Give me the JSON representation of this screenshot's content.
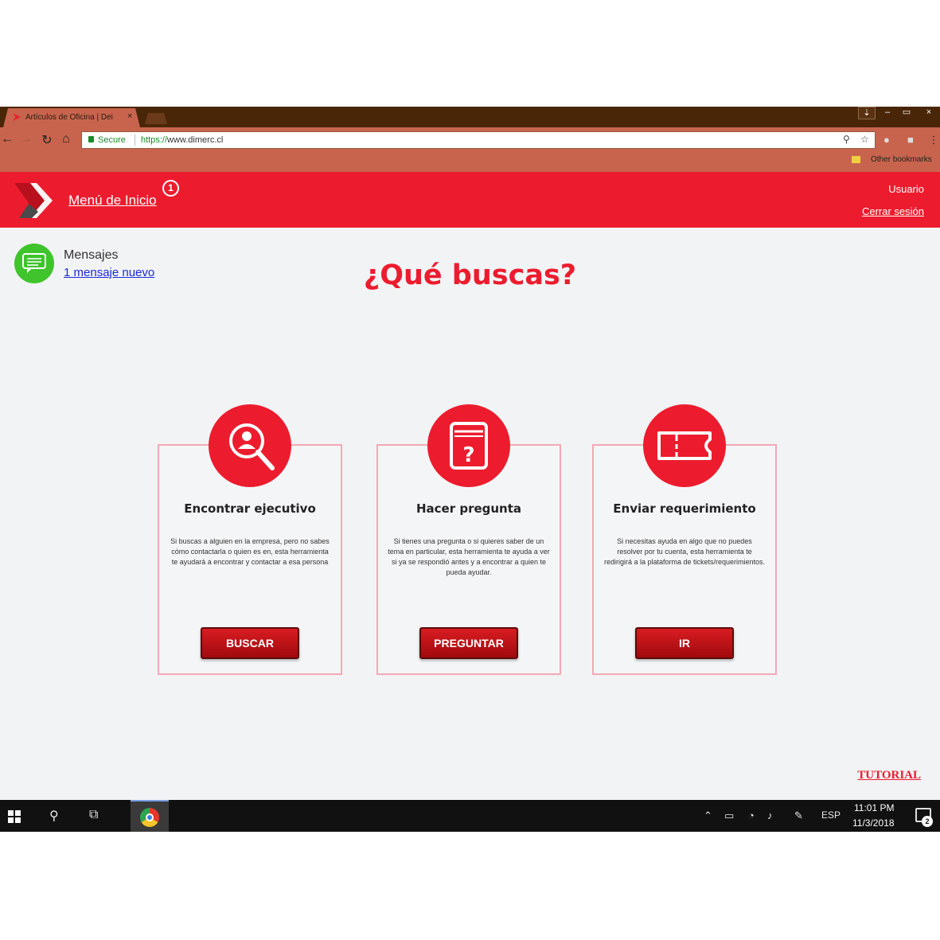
{
  "browser": {
    "tab_title": "Artículos de Oficina | Dei",
    "tab_close": "×",
    "window_controls": {
      "user": "⇣",
      "minimize": "–",
      "maximize": "▭",
      "close": "×"
    },
    "secure_label": "Secure",
    "url_protocol": "https://",
    "url_host": "www.dimerc.cl",
    "bookmarks_label": "Other bookmarks",
    "icons": [
      "back-icon",
      "forward-icon",
      "reload-icon",
      "home-icon",
      "lock-icon",
      "search-icon",
      "star-icon",
      "extension-icon",
      "menu-icon"
    ]
  },
  "header": {
    "menu_link": "Menú de Inicio",
    "notification_count": "1",
    "user_label": "Usuario",
    "logout_label": "Cerrar sesión",
    "bg_color": "#ec1c2e"
  },
  "messages": {
    "title": "Mensajes",
    "link": "1 mensaje nuevo",
    "icon": "chat-bubble-icon",
    "icon_color": "#3fc42c"
  },
  "main": {
    "heading": "¿Qué buscas?",
    "cards": [
      {
        "title": "Encontrar ejecutivo",
        "description": "Si buscas a alguien en la empresa, pero no sabes cómo contactarla o quien es en, esta herramienta te ayudará a encontrar y contactar a esa persona",
        "button": "BUSCAR",
        "icon": "search-person-icon"
      },
      {
        "title": "Hacer pregunta",
        "description": "Si tienes una pregunta o si quieres saber de un tema en particular, esta herramienta te ayuda a ver si ya se respondió antes y a encontrar a quien te pueda ayudar.",
        "button": "PREGUNTAR",
        "icon": "question-card-icon"
      },
      {
        "title": "Enviar requerimiento",
        "description": "Si necesitas ayuda en algo que no puedes resolver por tu cuenta, esta herramienta te redirigirá a la plataforma de tickets/requerimientos.",
        "button": "IR",
        "icon": "ticket-icon"
      }
    ],
    "tutorial": "TUTORIAL"
  },
  "taskbar": {
    "language": "ESP",
    "time": "11:01 PM",
    "date": "11/3/2018",
    "notification_count": "2"
  }
}
